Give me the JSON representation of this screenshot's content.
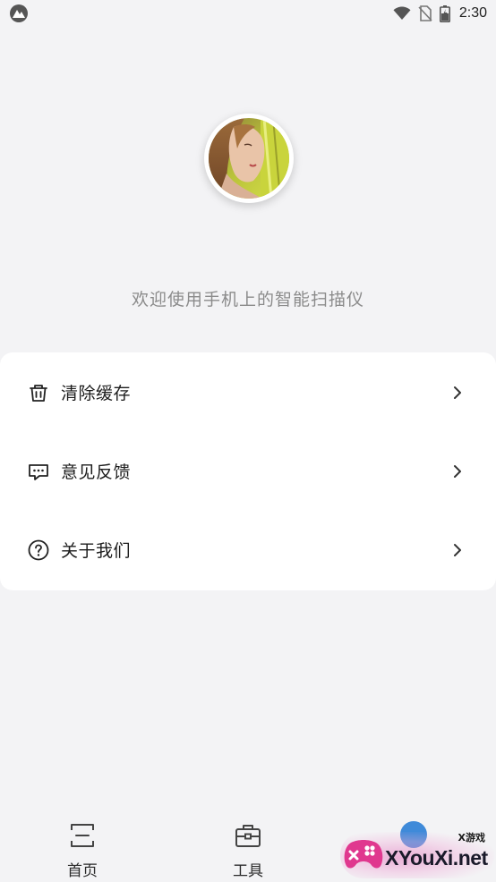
{
  "status_bar": {
    "time": "2:30",
    "left_icon": "notification-app-icon",
    "icons": [
      "wifi-icon",
      "no-sim-icon",
      "battery-icon"
    ]
  },
  "profile": {
    "welcome_text": "欢迎使用手机上的智能扫描仪"
  },
  "menu": {
    "items": [
      {
        "label": "清除缓存",
        "icon": "trash-icon"
      },
      {
        "label": "意见反馈",
        "icon": "message-icon"
      },
      {
        "label": "关于我们",
        "icon": "help-circle-icon"
      }
    ]
  },
  "bottom_nav": {
    "items": [
      {
        "label": "首页",
        "icon": "scan-frame-icon"
      },
      {
        "label": "工具",
        "icon": "toolbox-icon"
      }
    ]
  },
  "watermark": {
    "text": "XYouXi.net",
    "small_text": "X游戏"
  },
  "colors": {
    "background": "#f3f3f5",
    "card": "#ffffff",
    "welcome_text": "#8b8b8b",
    "accent_pink": "#e0388f"
  }
}
